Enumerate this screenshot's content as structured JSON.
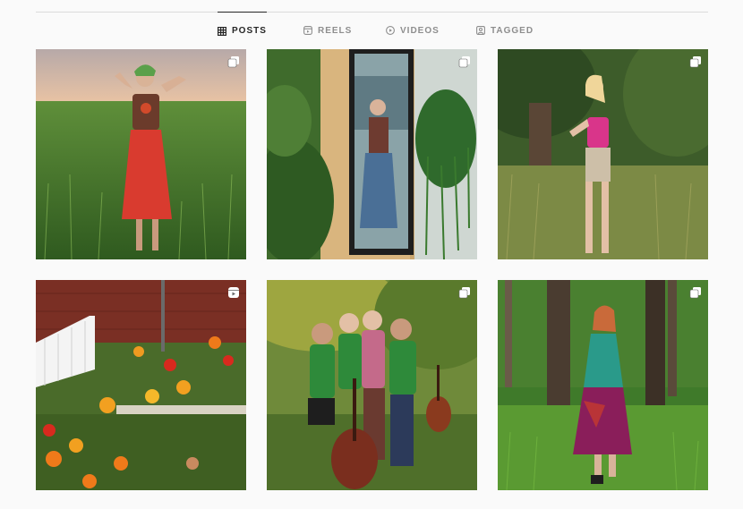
{
  "tabs": [
    {
      "label": "POSTS",
      "icon": "grid-icon",
      "active": true
    },
    {
      "label": "REELS",
      "icon": "reels-icon",
      "active": false
    },
    {
      "label": "VIDEOS",
      "icon": "video-icon",
      "active": false
    },
    {
      "label": "TAGGED",
      "icon": "tag-icon",
      "active": false
    }
  ],
  "posts": [
    {
      "name": "post-girl-red-skirt-field",
      "badge": "carousel-icon"
    },
    {
      "name": "post-mirror-selfie-plants",
      "badge": "carousel-icon"
    },
    {
      "name": "post-girl-pink-top-trees",
      "badge": "carousel-icon"
    },
    {
      "name": "post-garden-lilies-fence",
      "badge": "reel-icon"
    },
    {
      "name": "post-friends-green-shirts-cello",
      "badge": "carousel-icon"
    },
    {
      "name": "post-girl-colorful-dress-forest",
      "badge": "carousel-icon"
    }
  ],
  "colors": {
    "accent": "#262626",
    "inactive": "#8e8e8e",
    "divider": "#dbdbdb",
    "background": "#fafafa"
  }
}
